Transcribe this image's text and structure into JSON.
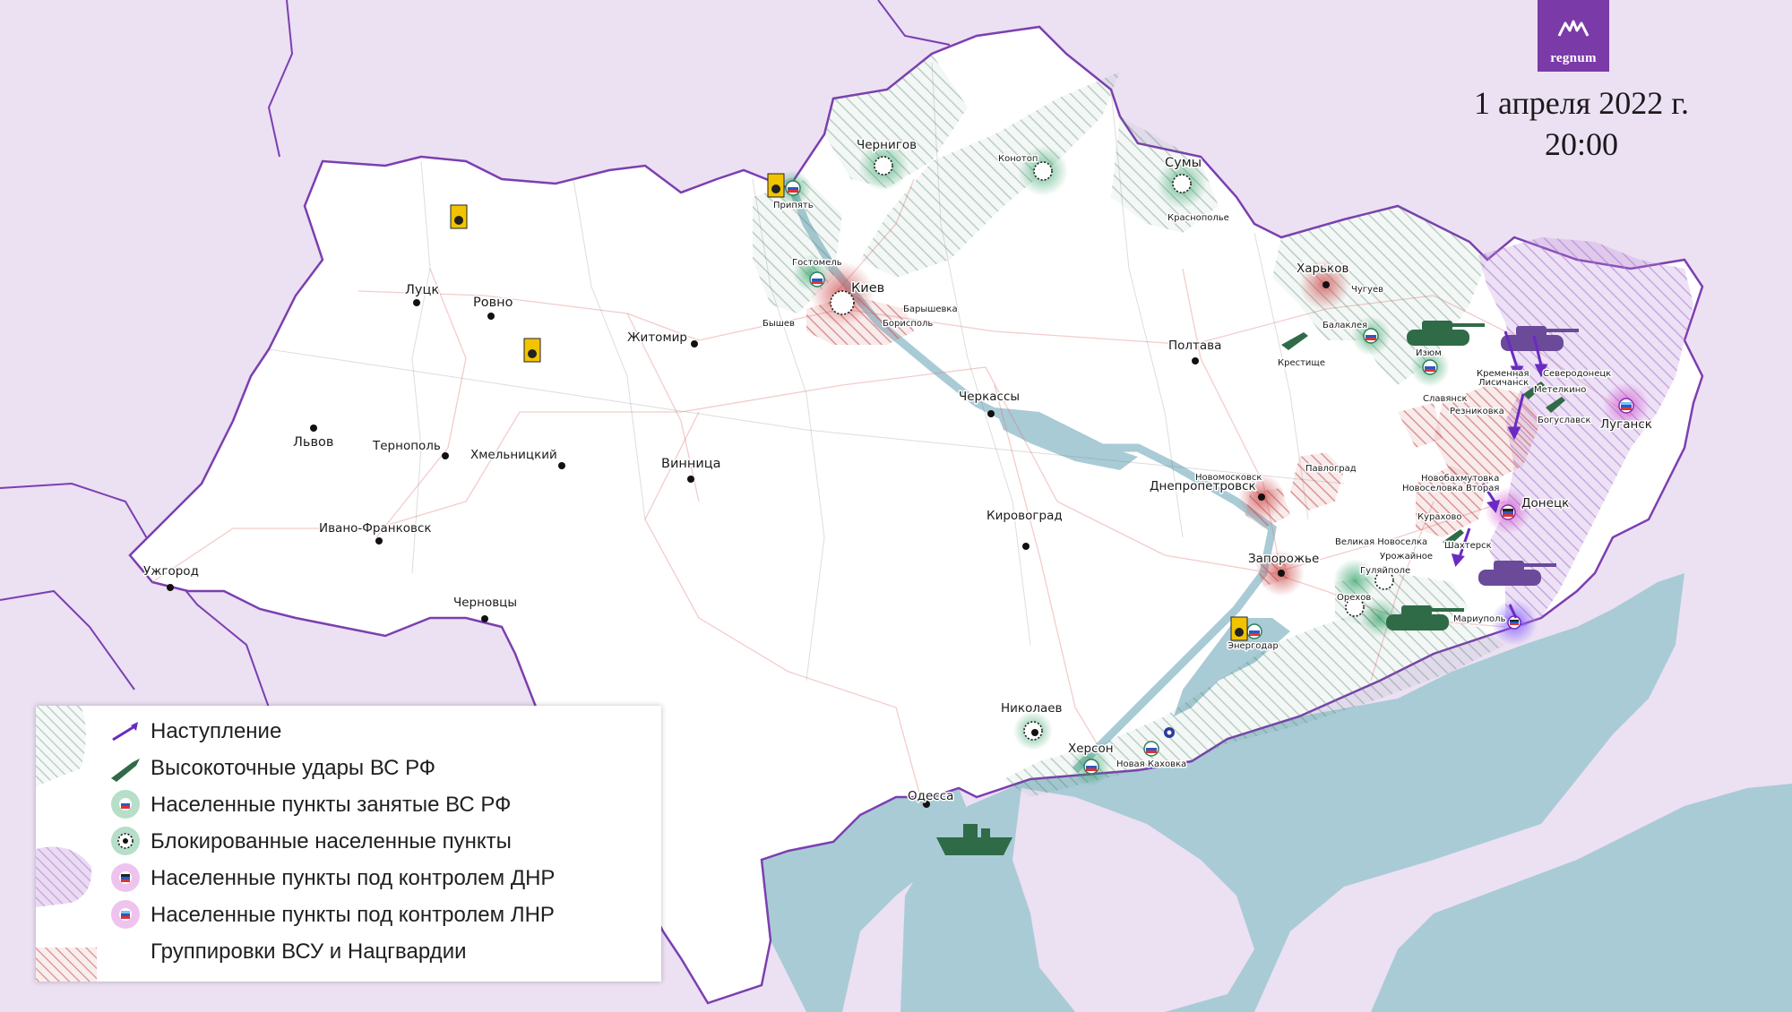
{
  "brand": {
    "logo_text": "regnum",
    "accent_color": "#7a3aa7"
  },
  "header": {
    "date": "1 апреля 2022 г.",
    "time": "20:00"
  },
  "colors": {
    "background": "#ece0f3",
    "land": "#ffffff",
    "sea": "#a9cbd6",
    "border": "#7b3fb0",
    "russian_zone": "#2e7d5b",
    "dnr_lnr_zone": "#b889d8",
    "ukr_forces": "#c65b5b",
    "advance_arrow": "#6a2bc2",
    "strike_icon": "#2f6b47"
  },
  "cities": {
    "lutsk": "Луцк",
    "rovno": "Ровно",
    "lvov": "Львов",
    "ternopol": "Тернополь",
    "khmelnitsky": "Хмельницкий",
    "ivano_frankovsk": "Ивано-Франковск",
    "uzhgorod": "Ужгород",
    "chernovtsy": "Черновцы",
    "zhitomir": "Житомир",
    "vinnitsa": "Винница",
    "kiev": "Киев",
    "gostomel": "Гостомель",
    "borispol": "Борисполь",
    "baryshevka": "Барышевка",
    "byshev": "Бышев",
    "pripyat": "Припять",
    "chernigov": "Чернигов",
    "konotop": "Конотоп",
    "sumy": "Сумы",
    "krasnopolye": "Краснополье",
    "kharkov": "Харьков",
    "chuguev": "Чугуев",
    "balakleya": "Балаклея",
    "izyum": "Изюм",
    "poltava": "Полтава",
    "krestishche": "Крестище",
    "cherkassy": "Черкассы",
    "kirovograd": "Кировоград",
    "dnepropetrovsk": "Днепропетровск",
    "novomoskovsk": "Новомосковск",
    "pavlograd": "Павлоград",
    "zaporozhye": "Запорожье",
    "energodar": "Энергодар",
    "gulyaipole": "Гуляйполе",
    "orekhov": "Орехов",
    "nikolaev": "Николаев",
    "kherson": "Херсон",
    "novaya_kakhovka": "Новая Каховка",
    "odessa": "Одесса",
    "slavyansk": "Славянск",
    "kremennaya": "Кременная",
    "lisichansk": "Лисичанск",
    "severodonetsk": "Северодонецк",
    "metelkino": "Метелкино",
    "rubezhnoe": "Резниковка",
    "bogoslavsk": "Богуславск",
    "lugansk": "Луганск",
    "donetsk": "Донецк",
    "novobakhmutovka": "Новобахмутовка",
    "novoselovka": "Новоселовка Вторая",
    "kurakhovo": "Курахово",
    "shakhtersk": "Шахтерск",
    "velikaya_novoselka": "Великая Новоселка",
    "urozhainoe": "Урожайное",
    "mariupol": "Мариуполь"
  },
  "legend": [
    {
      "icon": "arrow-icon",
      "label": "Наступление"
    },
    {
      "icon": "missile-icon",
      "label": "Высокоточные удары ВС РФ"
    },
    {
      "icon": "ru-occupied-icon",
      "label": "Населенные пункты занятые ВС РФ"
    },
    {
      "icon": "blocked-icon",
      "label": "Блокированные населенные пункты"
    },
    {
      "icon": "dnr-icon",
      "label": "Населенные пункты под контролем ДНР"
    },
    {
      "icon": "lnr-icon",
      "label": "Населенные пункты под контролем ЛНР"
    },
    {
      "icon": "ukr-groups-icon",
      "label": "Группировки ВСУ и Нацгвардии"
    }
  ]
}
